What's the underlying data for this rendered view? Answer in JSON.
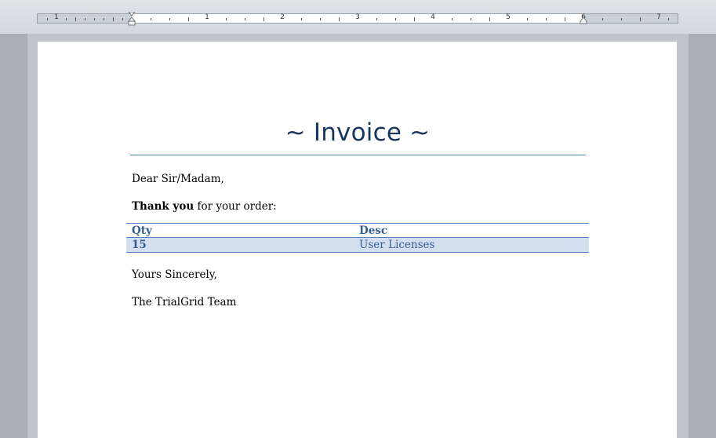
{
  "ruler": {
    "numbers": [
      "1",
      "1",
      "2",
      "3",
      "4",
      "5",
      "6",
      "7"
    ]
  },
  "document": {
    "title": "~ Invoice ~",
    "greeting": "Dear Sir/Madam,",
    "thanks_bold": "Thank you",
    "thanks_rest": " for your order:",
    "table": {
      "headers": [
        "Qty",
        "Desc"
      ],
      "rows": [
        [
          "15",
          "User Licenses"
        ]
      ]
    },
    "closing": "Yours Sincerely,",
    "signature": "The TrialGrid Team"
  },
  "colors": {
    "title": "#17365d",
    "accent": "#4f81bd",
    "table_text": "#365f91",
    "row_band": "#d3dfee"
  }
}
